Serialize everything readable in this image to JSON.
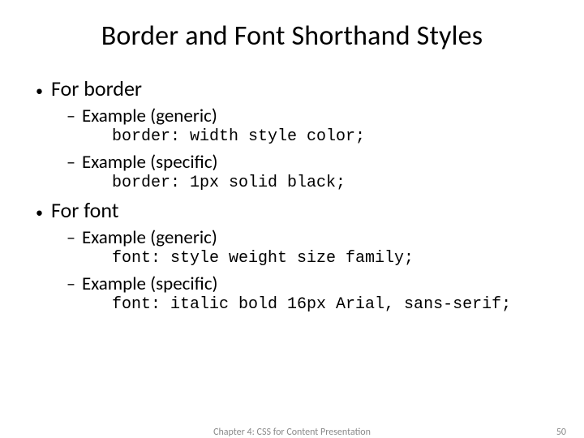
{
  "title": "Border and Font Shorthand Styles",
  "sections": [
    {
      "heading": "For border",
      "items": [
        {
          "label": "Example (generic)",
          "code": "border: width style color;"
        },
        {
          "label": "Example (specific)",
          "code": "border: 1px solid black;"
        }
      ]
    },
    {
      "heading": "For font",
      "items": [
        {
          "label": "Example (generic)",
          "code": "font: style weight size family;"
        },
        {
          "label": "Example (specific)",
          "code": "font: italic bold 16px Arial, sans-serif;"
        }
      ]
    }
  ],
  "footer": {
    "chapter": "Chapter 4: CSS for Content Presentation",
    "page": "50"
  }
}
